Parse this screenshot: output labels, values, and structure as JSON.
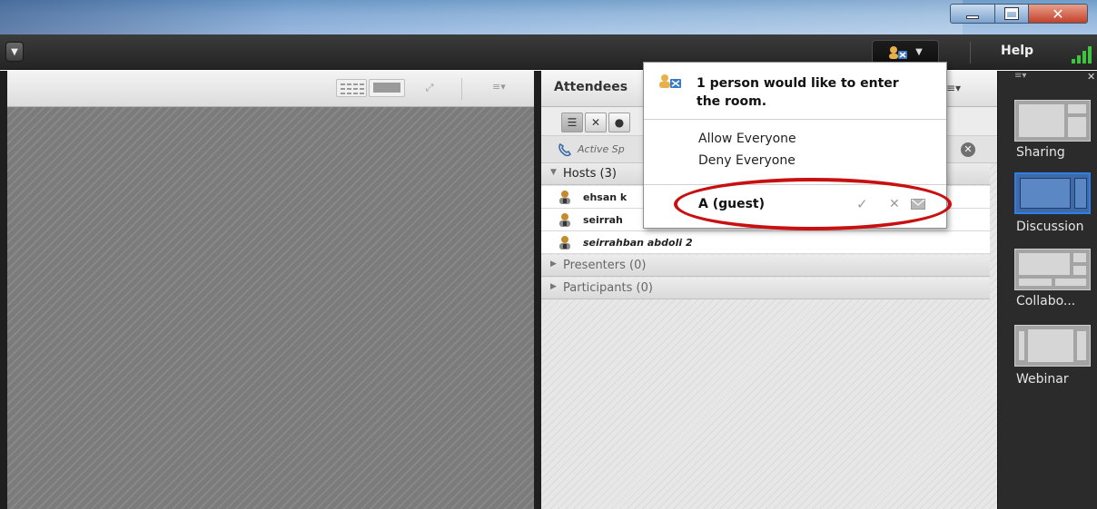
{
  "window": {
    "controls": {
      "minimize_icon": "minimize-icon",
      "maximize_icon": "maximize-icon",
      "close_icon": "close-icon"
    }
  },
  "menubar": {
    "help_label": "Help",
    "icons": [
      "chevron-down-icon",
      "attendee-status-icon",
      "connection-signal-icon"
    ],
    "accent_signal": "#3fc43f"
  },
  "left_pod": {
    "icons": [
      "grid-view-icon",
      "filmstrip-view-icon",
      "fullscreen-icon",
      "pod-menu-icon"
    ]
  },
  "attendees": {
    "title": "Attendees",
    "active_speakers_label": "Active Sp",
    "groups": {
      "hosts": "Hosts (3)",
      "presenters": "Presenters (0)",
      "participants": "Participants (0)"
    },
    "users": [
      {
        "name": "ehsan k"
      },
      {
        "name": "seirrah"
      },
      {
        "name": "seirrahban abdoli 2"
      }
    ]
  },
  "entry_popup": {
    "message": "1 person would like to enter the room.",
    "allow_all": "Allow Everyone",
    "deny_all": "Deny Everyone",
    "guest": "A (guest)",
    "highlight_color": "#c81010"
  },
  "layouts": {
    "items": [
      {
        "label": "Sharing",
        "selected": false
      },
      {
        "label": "Discussion",
        "selected": true
      },
      {
        "label": "Collabo...",
        "selected": false
      },
      {
        "label": "Webinar",
        "selected": false
      }
    ],
    "selected_color": "#2f7fe6"
  }
}
